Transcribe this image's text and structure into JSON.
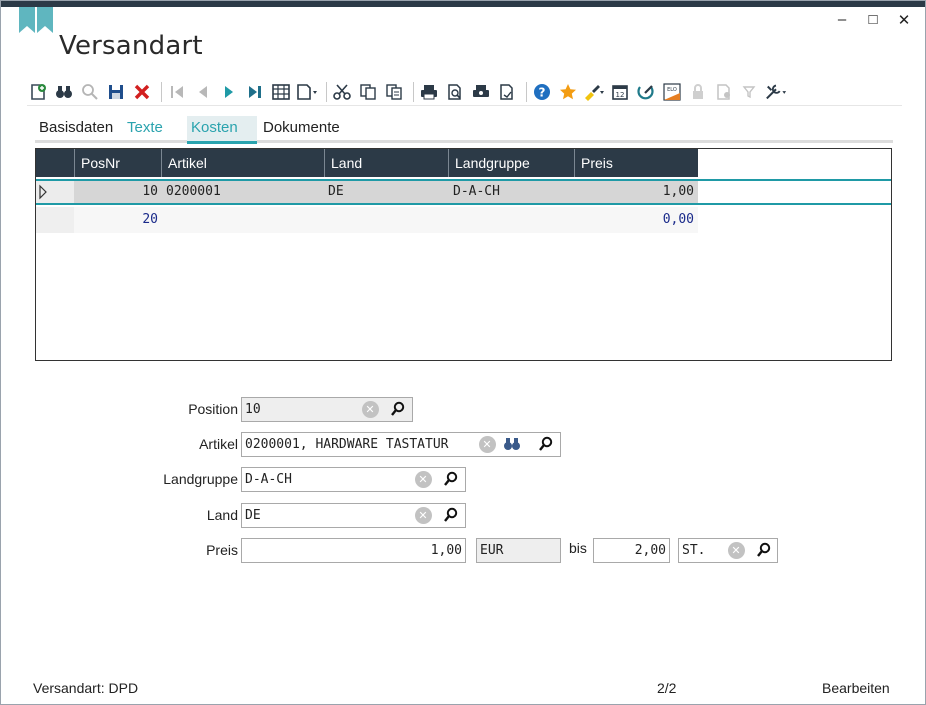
{
  "window": {
    "title": "Versandart",
    "controls": [
      "minimize-icon",
      "maximize-icon",
      "close-icon"
    ]
  },
  "toolbar": {
    "icons": [
      "new-doc-icon",
      "binoculars-icon",
      "search-icon",
      "save-icon",
      "delete-icon",
      "first-icon",
      "prev-icon",
      "next-icon",
      "last-icon",
      "table-icon",
      "copy-doc-icon",
      "cut-icon",
      "copy-icon",
      "paste-icon",
      "print-icon",
      "print-preview-icon",
      "print-setup-icon",
      "preview-icon",
      "help-icon",
      "favorite-star-icon",
      "brush-icon",
      "calendar-icon",
      "edit-icon",
      "elo-icon",
      "lock-icon",
      "doc-settings-icon",
      "filter-icon",
      "tools-icon"
    ]
  },
  "tabs": [
    {
      "label": "Basisdaten",
      "state": "normal"
    },
    {
      "label": "Texte",
      "state": "teal"
    },
    {
      "label": "Kosten",
      "state": "active"
    },
    {
      "label": "Dokumente",
      "state": "normal"
    }
  ],
  "grid": {
    "columns": [
      "PosNr",
      "Artikel",
      "Land",
      "Landgruppe",
      "Preis"
    ],
    "rows": [
      {
        "posnr": "10",
        "artikel": "0200001",
        "land": "DE",
        "landgruppe": "D-A-CH",
        "preis": "1,00",
        "selected": true
      },
      {
        "posnr": "20",
        "artikel": "",
        "land": "",
        "landgruppe": "",
        "preis": "0,00",
        "selected": false
      }
    ]
  },
  "form": {
    "position": {
      "label": "Position",
      "value": "10"
    },
    "artikel": {
      "label": "Artikel",
      "value": "0200001, HARDWARE TASTATUR"
    },
    "landgruppe": {
      "label": "Landgruppe",
      "value": "D-A-CH"
    },
    "land": {
      "label": "Land",
      "value": "DE"
    },
    "preis": {
      "label": "Preis",
      "value": "1,00",
      "currency": "EUR",
      "bis_label": "bis",
      "bis_value": "2,00",
      "unit": "ST."
    }
  },
  "status": {
    "left": "Versandart: DPD",
    "center": "2/2",
    "right": "Bearbeiten"
  },
  "colors": {
    "accent": "#2aa3ae",
    "header": "#2c3a47"
  }
}
